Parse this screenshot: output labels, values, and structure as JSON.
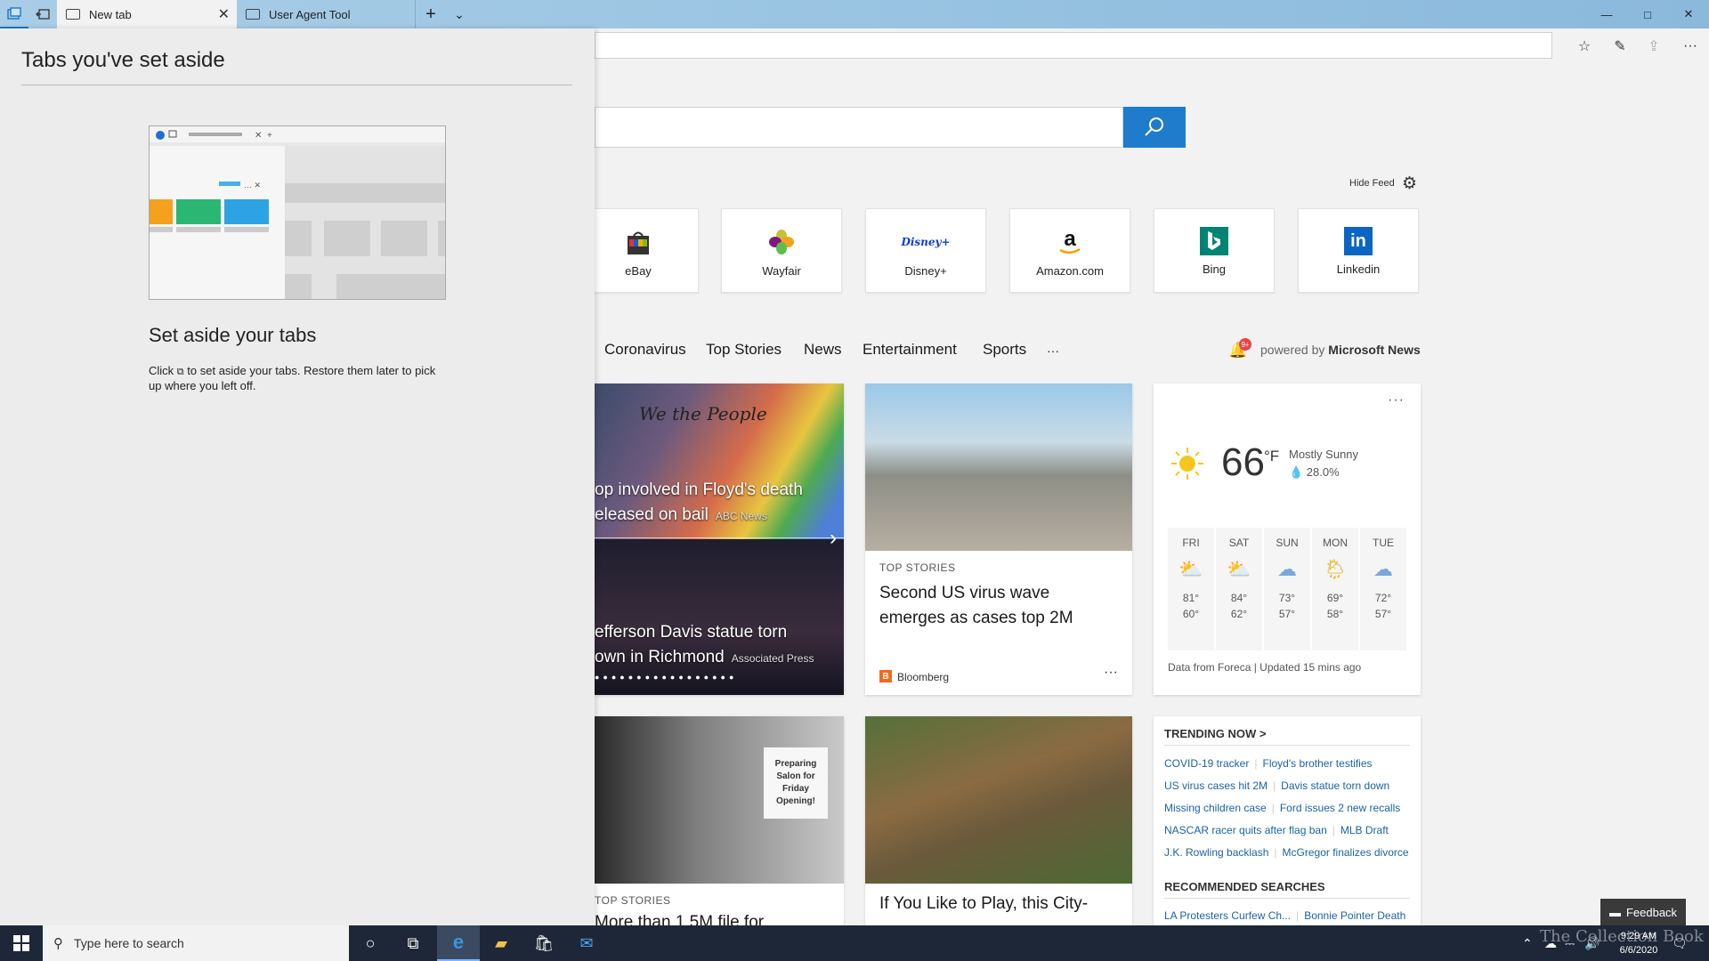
{
  "tabs": [
    {
      "label": "New tab",
      "icon": "newtab-icon",
      "active": true
    },
    {
      "label": "User Agent Tool",
      "icon": "page-icon",
      "active": false
    }
  ],
  "titlebar": {
    "new_tab_glyph": "+",
    "dropdown_glyph": "⌄",
    "minimize": "—",
    "maximize": "□",
    "close": "✕"
  },
  "search": {
    "placeholder": ""
  },
  "feed": {
    "hide_label": "Hide Feed"
  },
  "tiles": [
    {
      "label": "eBay",
      "icon": "ebay-bag-icon"
    },
    {
      "label": "Wayfair",
      "icon": "wayfair-icon"
    },
    {
      "label": "Disney+",
      "icon": "disney-plus-icon"
    },
    {
      "label": "Amazon.com",
      "icon": "amazon-icon"
    },
    {
      "label": "Bing",
      "icon": "bing-icon"
    },
    {
      "label": "Linkedin",
      "icon": "linkedin-icon"
    }
  ],
  "nav": {
    "items": [
      "Coronavirus",
      "Top Stories",
      "News",
      "Entertainment",
      "Sports",
      "···"
    ],
    "notification_badge": "9+",
    "powered_prefix": "powered by",
    "powered_brand": "Microsoft News"
  },
  "hero": {
    "headline1_line1": "op involved in Floyd's death",
    "headline1_line2": "eleased on bail",
    "source1": "ABC News",
    "headline2_line1": "efferson Davis statue torn",
    "headline2_line2": "own in Richmond",
    "source2": "Associated Press",
    "mural_text": "We the People"
  },
  "story": {
    "category": "TOP STORIES",
    "title": "Second US virus wave emerges as cases top 2M",
    "source": "Bloomberg",
    "source_badge": "B",
    "more": "···"
  },
  "weather": {
    "temp": "66",
    "unit": "°F",
    "condition": "Mostly Sunny",
    "precip": "💧 28.0%",
    "more": "···",
    "days": [
      {
        "name": "FRI",
        "hi": "81°",
        "lo": "60°",
        "icon": "partly-sunny-icon"
      },
      {
        "name": "SAT",
        "hi": "84°",
        "lo": "62°",
        "icon": "partly-sunny-icon"
      },
      {
        "name": "SUN",
        "hi": "73°",
        "lo": "57°",
        "icon": "rain-cloud-icon"
      },
      {
        "name": "MON",
        "hi": "69°",
        "lo": "58°",
        "icon": "sun-shower-icon"
      },
      {
        "name": "TUE",
        "hi": "72°",
        "lo": "57°",
        "icon": "rain-cloud-icon"
      }
    ],
    "footer": "Data from Foreca | Updated 15 mins ago"
  },
  "hero2": {
    "category": "TOP STORIES",
    "title": "More than 1.5M file for",
    "sign": "Preparing Salon for Friday Opening!"
  },
  "story2": {
    "title": "If You Like to Play, this City-"
  },
  "trending": {
    "heading": "TRENDING NOW >",
    "rows": [
      [
        "COVID-19 tracker",
        "Floyd's brother testifies"
      ],
      [
        "US virus cases hit 2M",
        "Davis statue torn down"
      ],
      [
        "Missing children case",
        "Ford issues 2 new recalls"
      ],
      [
        "NASCAR racer quits after flag ban",
        "MLB Draft"
      ],
      [
        "J.K. Rowling backlash",
        "McGregor finalizes divorce"
      ]
    ],
    "rec_heading": "RECOMMENDED SEARCHES",
    "rec_row": [
      "LA Protesters Curfew Ch...",
      "Bonnie Pointer Death"
    ]
  },
  "flyout": {
    "title": "Tabs you've set aside",
    "heading": "Set aside your tabs",
    "desc_before": "Click",
    "desc_after": "to set aside your tabs. Restore them later to pick up where you left off."
  },
  "feedback": {
    "label": "Feedback"
  },
  "taskbar": {
    "search_placeholder": "Type here to search",
    "time": "9:29 AM",
    "date": "6/6/2020"
  },
  "watermark": "The Collection Book",
  "colors": {
    "accent": "#1f7ccc",
    "taskbar": "#1d2737",
    "link": "#1b63a6"
  }
}
